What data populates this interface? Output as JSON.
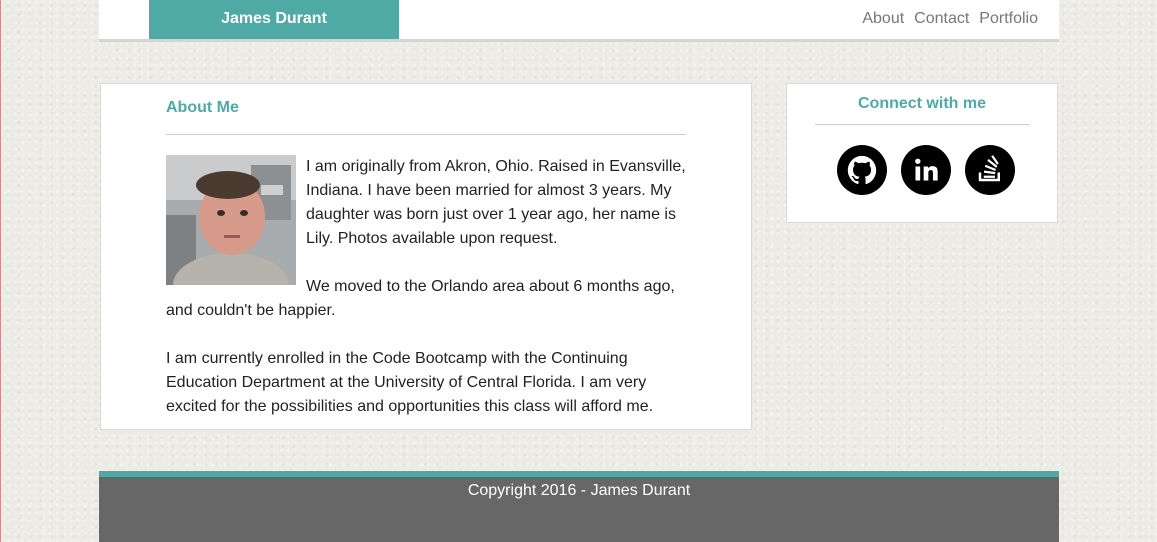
{
  "header": {
    "brand": "James Durant",
    "nav": [
      "About",
      "Contact",
      "Portfolio"
    ]
  },
  "about": {
    "title": "About Me",
    "paragraphs": [
      "I am originally from Akron, Ohio. Raised in Evansville, Indiana. I have been married for almost 3 years. My daughter was born just over 1 year ago, her name is Lily. Photos available upon request.",
      "We moved to the Orlando area about 6 months ago, and couldn't be happier.",
      "I am currently enrolled in the Code Bootcamp with the Continuing Education Department at the University of Central Florida. I am very excited for the possibilities and opportunities this class will afford me."
    ]
  },
  "connect": {
    "title": "Connect with me",
    "icons": [
      "github-icon",
      "linkedin-icon",
      "stackoverflow-icon"
    ]
  },
  "footer": {
    "copyright": "Copyright 2016 - James Durant"
  },
  "colors": {
    "accent": "#4fa9a5",
    "footer": "#676767",
    "header_bg": "#ffffff",
    "nav_text": "#777777"
  }
}
